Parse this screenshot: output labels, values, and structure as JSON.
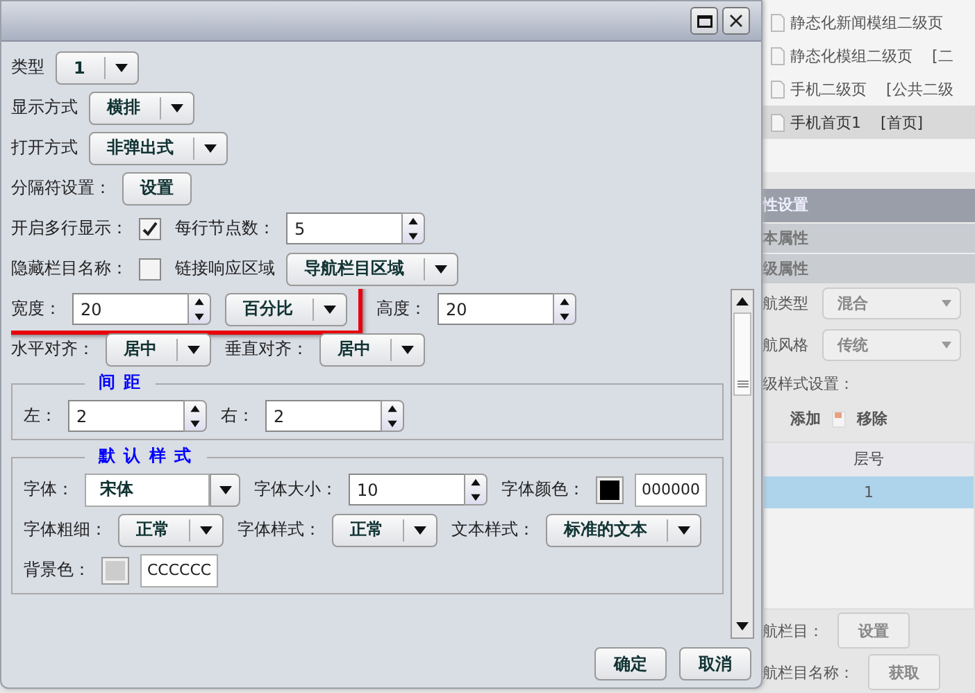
{
  "dialog": {
    "top_rows": [
      [
        {
          "kind": "select",
          "label": "类型",
          "value": "1"
        }
      ],
      [
        {
          "kind": "select",
          "label": "显示方式",
          "value": "横排"
        }
      ],
      [
        {
          "kind": "select",
          "label": "打开方式",
          "value": "非弹出式"
        }
      ],
      [
        {
          "kind": "button",
          "label": "分隔符设置：",
          "value": "设置"
        }
      ],
      [
        {
          "kind": "checkbox",
          "label": "开启多行显示：",
          "checked": true
        },
        {
          "kind": "spinner",
          "label": "每行节点数：",
          "value": "5"
        }
      ],
      [
        {
          "kind": "checkbox",
          "label": "隐藏栏目名称：",
          "checked": false
        },
        {
          "kind": "select",
          "label": "链接响应区域",
          "value": "导航栏目区域"
        }
      ]
    ],
    "scroll_rows": [
      {
        "highlight_group": [
          {
            "kind": "spinner",
            "label": "宽度：",
            "value": "20"
          },
          {
            "kind": "select",
            "value": "百分比"
          }
        ],
        "items": [
          {
            "kind": "spinner",
            "label": "高度：",
            "value": "20"
          }
        ]
      },
      {
        "items": [
          {
            "kind": "select",
            "label": "水平对齐：",
            "value": "居中"
          },
          {
            "kind": "select",
            "label": "垂直对齐：",
            "value": "居中"
          }
        ]
      }
    ],
    "fieldsets": [
      {
        "title": "间 距",
        "rows": [
          [
            {
              "kind": "spinner",
              "label": "左：",
              "value": "2"
            },
            {
              "kind": "spinner",
              "label": "右：",
              "value": "2"
            }
          ]
        ]
      },
      {
        "title": "默 认 样 式",
        "rows": [
          [
            {
              "kind": "combo",
              "label": "字体：",
              "value": "宋体"
            },
            {
              "kind": "spinner",
              "label": "字体大小：",
              "value": "10"
            },
            {
              "kind": "color",
              "label": "字体颜色：",
              "color": "#000000",
              "value": "000000"
            }
          ],
          [
            {
              "kind": "select",
              "label": "字体粗细：",
              "value": "正常"
            },
            {
              "kind": "select",
              "label": "字体样式：",
              "value": "正常"
            },
            {
              "kind": "select",
              "label": "文本样式：",
              "value": "标准的文本"
            }
          ],
          [
            {
              "kind": "color",
              "label": "背景色：",
              "color": "#cccccc",
              "value": "CCCCCC"
            }
          ]
        ]
      }
    ],
    "buttons": [
      "确定",
      "取消"
    ]
  },
  "background_panel": {
    "pages": [
      {
        "name": "静态化新闻模组二级页",
        "selected": false
      },
      {
        "name": "静态化模组二级页",
        "tag": "[二",
        "selected": false
      },
      {
        "name": "手机二级页",
        "tag": "[公共二级",
        "selected": false
      },
      {
        "name": "手机首页1",
        "tag": "[首页]",
        "selected": true
      }
    ],
    "header": "性设置",
    "sections": [
      "本属性",
      "级属性"
    ],
    "selects": [
      {
        "label": "航类型",
        "value": "混合"
      },
      {
        "label": "航风格",
        "value": "传统"
      }
    ],
    "style_label": "级样式设置：",
    "actions": [
      "添加",
      "移除"
    ],
    "table": {
      "column": "层号",
      "rows": [
        {
          "value": "1",
          "selected": true
        }
      ]
    },
    "fields": [
      {
        "label": "航栏目：",
        "button": "设置"
      },
      {
        "label": "航栏目名称：",
        "button": "获取"
      }
    ]
  }
}
